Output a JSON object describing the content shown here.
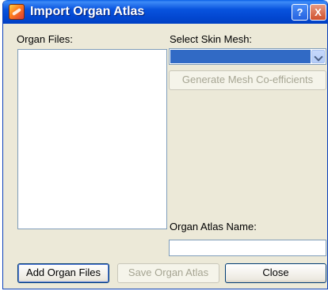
{
  "window": {
    "title": "Import Organ Atlas",
    "help_glyph": "?",
    "close_glyph": "X",
    "app_icon": "organ-atlas-app-icon"
  },
  "organ_files": {
    "label": "Organ Files:",
    "items": []
  },
  "skin_mesh": {
    "label": "Select Skin Mesh:",
    "selected_value": ""
  },
  "generate_button": {
    "label": "Generate Mesh Co-efficients",
    "enabled": false
  },
  "atlas_name": {
    "label": "Organ Atlas Name:",
    "value": ""
  },
  "buttons": {
    "add": "Add Organ Files",
    "save": "Save Organ Atlas",
    "close": "Close"
  },
  "colors": {
    "titlebar": "#0348d2",
    "dialog_bg": "#ece9d8",
    "selection": "#316ac5",
    "disabled_text": "#a6a593"
  }
}
